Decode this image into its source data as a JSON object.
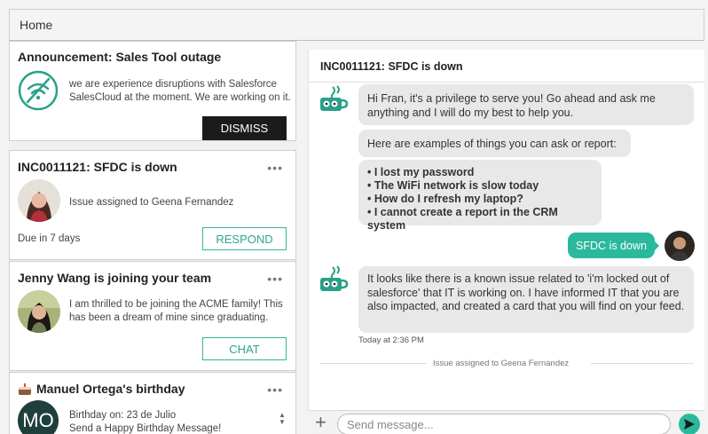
{
  "topbar": {
    "title": "Home"
  },
  "announcement": {
    "title": "Announcement: Sales Tool outage",
    "text": "we are experience disruptions with Salesforce SalesCloud at the moment. We are working on it.",
    "icon": "no-wifi-icon",
    "button": "DISMISS"
  },
  "incident_card": {
    "title": "INC0011121: SFDC is down",
    "more": "•••",
    "text": "Issue assigned to Geena Fernandez",
    "due": "Due in 7 days",
    "button": "RESPOND"
  },
  "join_card": {
    "title": "Jenny Wang is joining your team",
    "more": "•••",
    "text": "I am thrilled to be joining the ACME family! This has been a dream of mine since graduating.",
    "button": "CHAT"
  },
  "birthday_card": {
    "icon": "cake-icon",
    "title": "Manuel Ortega's birthday",
    "more": "•••",
    "avatar_initials": "MO",
    "line1": "Birthday on: 23 de Julio",
    "line2": "Send a Happy Birthday Message!"
  },
  "chat": {
    "title": "INC0011121: SFDC is down",
    "bot_icon": "coffee-cup-icon",
    "msg1": "Hi Fran, it's a privilege to serve you! Go ahead and ask me anything and I will do my best to help you.",
    "msg2": "Here are examples of things you can ask or report:",
    "examples": [
      "• I lost my password",
      "• The WiFi network is slow today",
      "• How do I refresh my laptop?",
      "• I cannot create a report in the CRM system"
    ],
    "user_msg": "SFDC is down",
    "msg3": "It looks like there is a known issue related to 'i'm locked out of salesforce' that IT is working on. I have informed IT that you are also impacted, and created a card that you will find on your feed.",
    "timestamp": "Today at 2:36 PM",
    "separator": "Issue assigned to Geena Fernandez"
  },
  "composer": {
    "plus": "+",
    "placeholder": "Send message..."
  },
  "colors": {
    "accent": "#2bb99d",
    "dark_button": "#1b1b1b",
    "bubble": "#e8e8e8"
  }
}
